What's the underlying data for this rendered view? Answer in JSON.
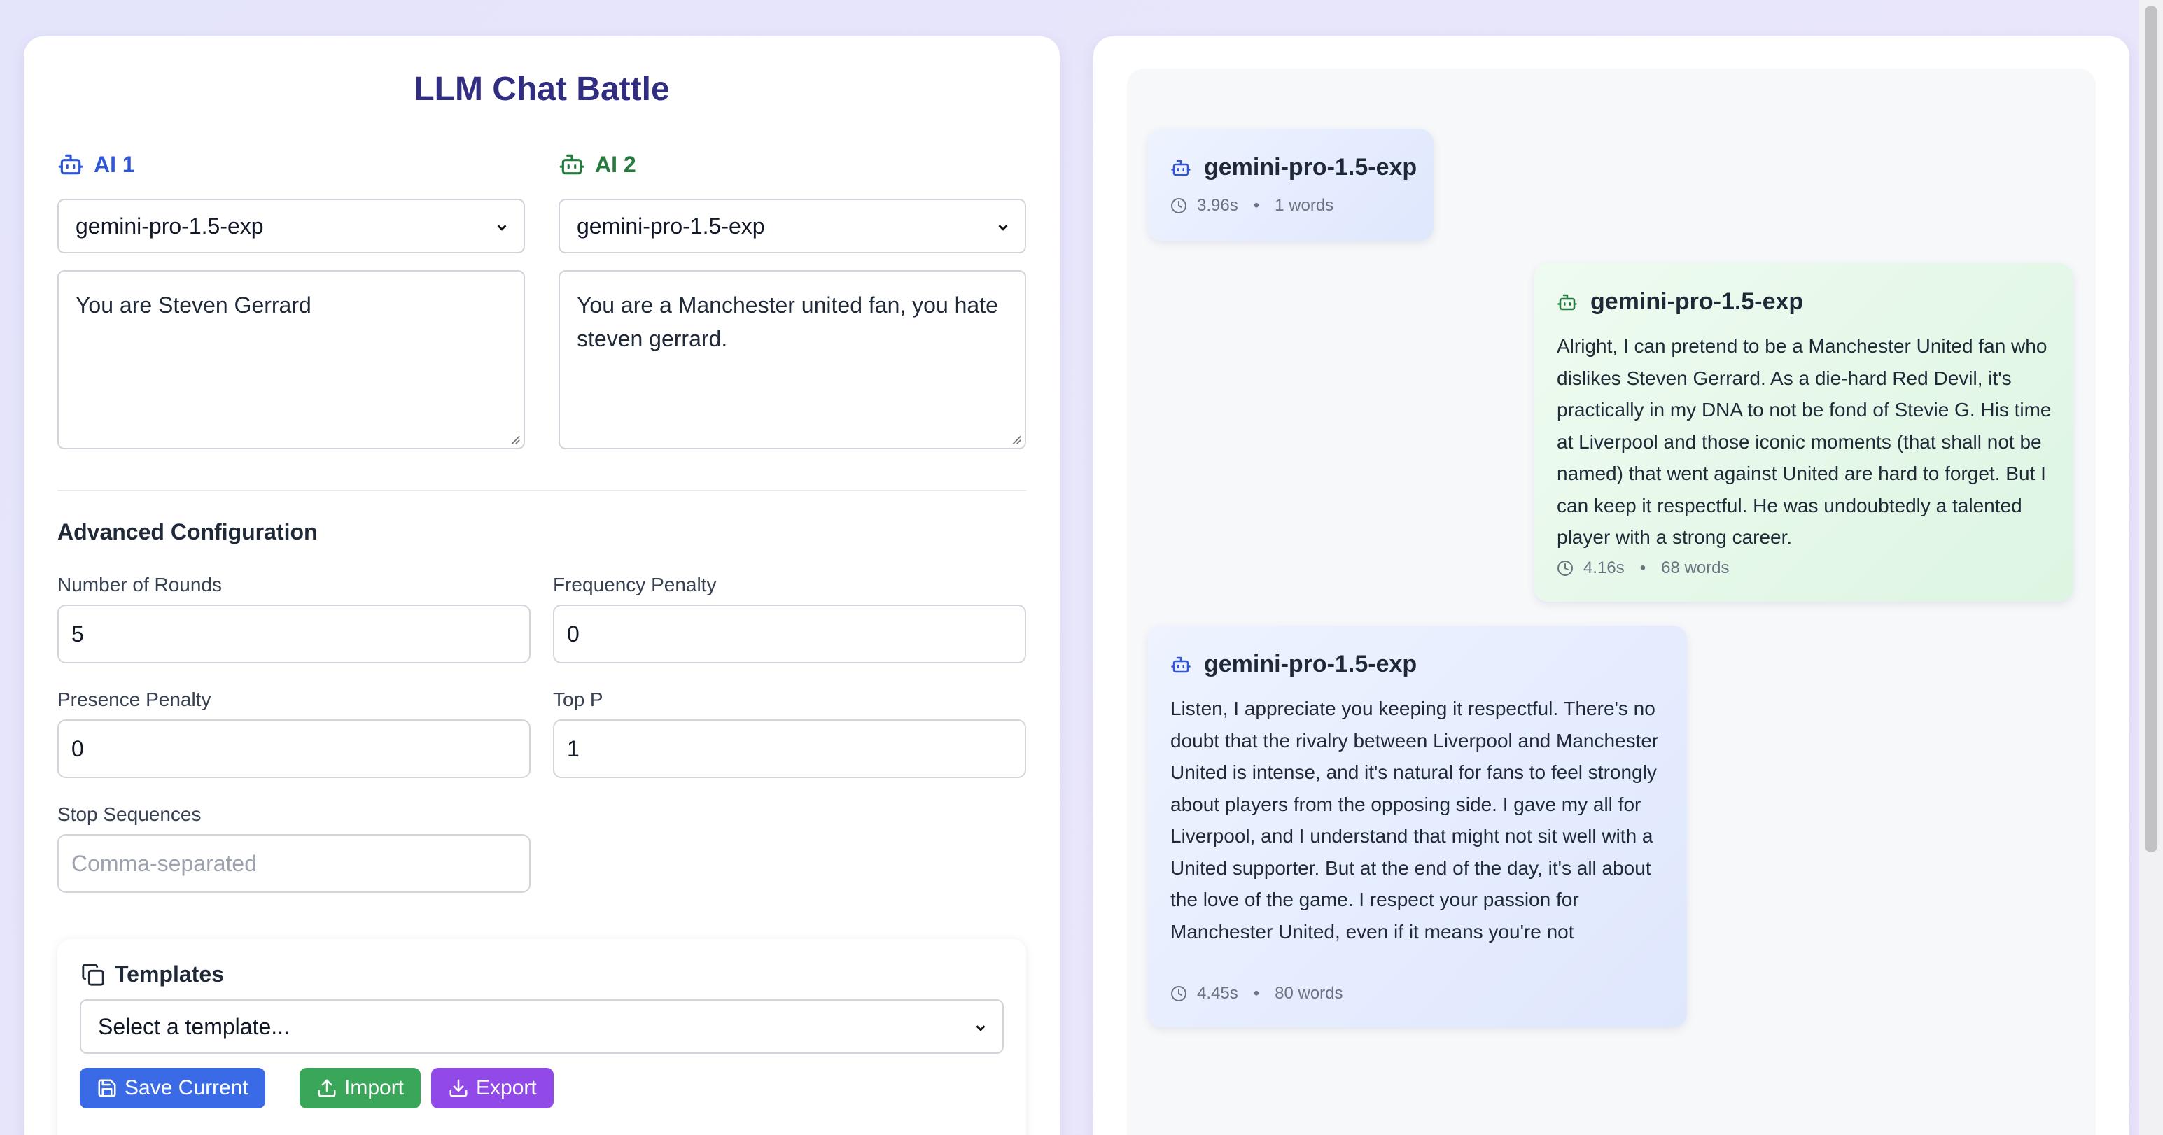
{
  "app": {
    "title": "LLM Chat Battle"
  },
  "ai1": {
    "label": "AI 1",
    "model": "gemini-pro-1.5-exp",
    "system_prompt": "You are Steven Gerrard",
    "color": "#2f56d6"
  },
  "ai2": {
    "label": "AI 2",
    "model": "gemini-pro-1.5-exp",
    "system_prompt": "You are a Manchester united fan, you hate steven gerrard.",
    "color": "#267a3e"
  },
  "advanced": {
    "title": "Advanced Configuration",
    "rounds_label": "Number of Rounds",
    "rounds_value": "5",
    "frequency_label": "Frequency Penalty",
    "frequency_value": "0",
    "presence_label": "Presence Penalty",
    "presence_value": "0",
    "top_p_label": "Top P",
    "top_p_value": "1",
    "stop_label": "Stop Sequences",
    "stop_placeholder": "Comma-separated"
  },
  "templates": {
    "title": "Templates",
    "select_placeholder": "Select a template...",
    "save_label": "Save Current",
    "import_label": "Import",
    "export_label": "Export"
  },
  "messages": [
    {
      "speaker": "ai1",
      "model": "gemini-pro-1.5-exp",
      "text": "",
      "time": "3.96s",
      "words": "1 words"
    },
    {
      "speaker": "ai2",
      "model": "gemini-pro-1.5-exp",
      "text": "Alright, I can pretend to be a Manchester United fan who dislikes Steven Gerrard. As a die-hard Red Devil, it's practically in my DNA to not be fond of Stevie G. His time at Liverpool and those iconic moments (that shall not be named) that went against United are hard to forget. But I can keep it respectful. He was undoubtedly a talented player with a strong career.",
      "time": "4.16s",
      "words": "68 words"
    },
    {
      "speaker": "ai1",
      "model": "gemini-pro-1.5-exp",
      "text": "Listen, I appreciate you keeping it respectful. There's no doubt that the rivalry between Liverpool and Manchester United is intense, and it's natural for fans to feel strongly about players from the opposing side. I gave my all for Liverpool, and I understand that might not sit well with a United supporter. But at the end of the day, it's all about the love of the game. I respect your passion for Manchester United, even if it means you're not",
      "time": "4.45s",
      "words": "80 words"
    }
  ],
  "icons": {
    "ai1": "bot-icon",
    "ai2": "bot-icon",
    "templates": "copy-icon",
    "save": "save-icon",
    "import": "upload-icon",
    "export": "download-icon",
    "meta": "clock-icon"
  }
}
